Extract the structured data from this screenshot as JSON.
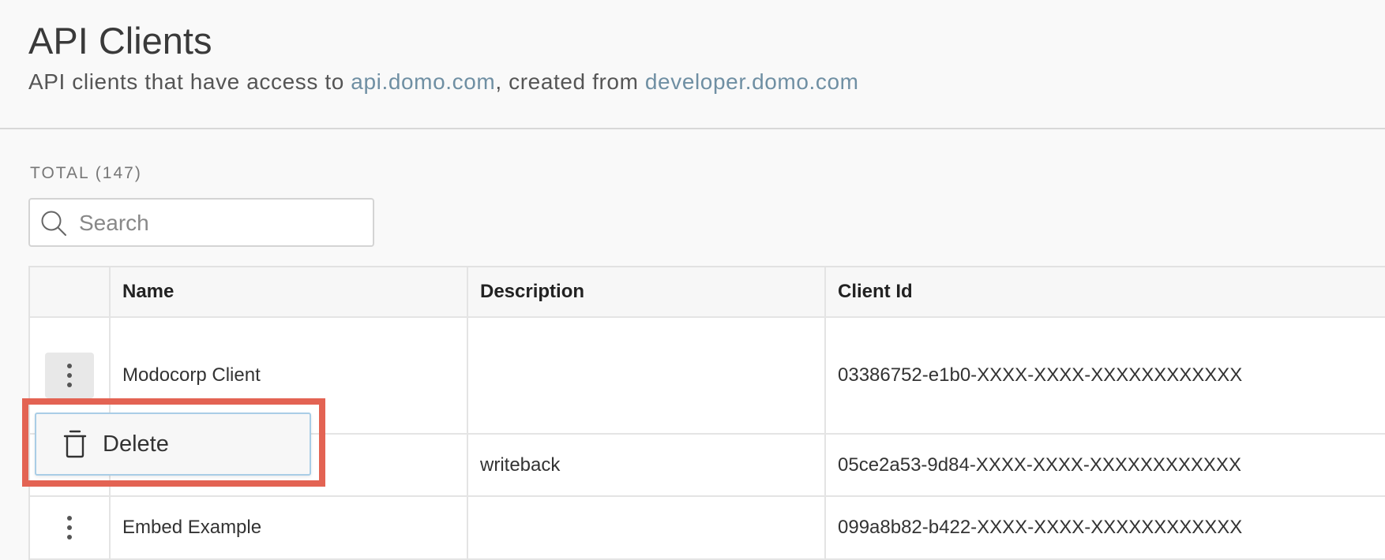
{
  "header": {
    "title": "API Clients",
    "subtitle_prefix": "API clients that have access to ",
    "subtitle_link1": "api.domo.com",
    "subtitle_middle": ", created from ",
    "subtitle_link2": "developer.domo.com"
  },
  "total_label": "TOTAL (147)",
  "search": {
    "placeholder": "Search",
    "value": "",
    "icon": "search-icon"
  },
  "table": {
    "columns": [
      "",
      "Name",
      "Description",
      "Client Id"
    ],
    "rows": [
      {
        "name": "Modocorp Client",
        "description": "",
        "client_id": "03386752-e1b0-XXXX-XXXX-XXXXXXXXXXXX"
      },
      {
        "name": "",
        "description": "writeback",
        "client_id": "05ce2a53-9d84-XXXX-XXXX-XXXXXXXXXXXX"
      },
      {
        "name": "Embed Example",
        "description": "",
        "client_id": "099a8b82-b422-XXXX-XXXX-XXXXXXXXXXXX"
      }
    ]
  },
  "context_menu": {
    "items": [
      {
        "label": "Delete",
        "icon": "trash-icon"
      }
    ]
  },
  "colors": {
    "link": "#6f8fa3",
    "highlight": "#e36353",
    "menu_border": "#a9cde6"
  }
}
